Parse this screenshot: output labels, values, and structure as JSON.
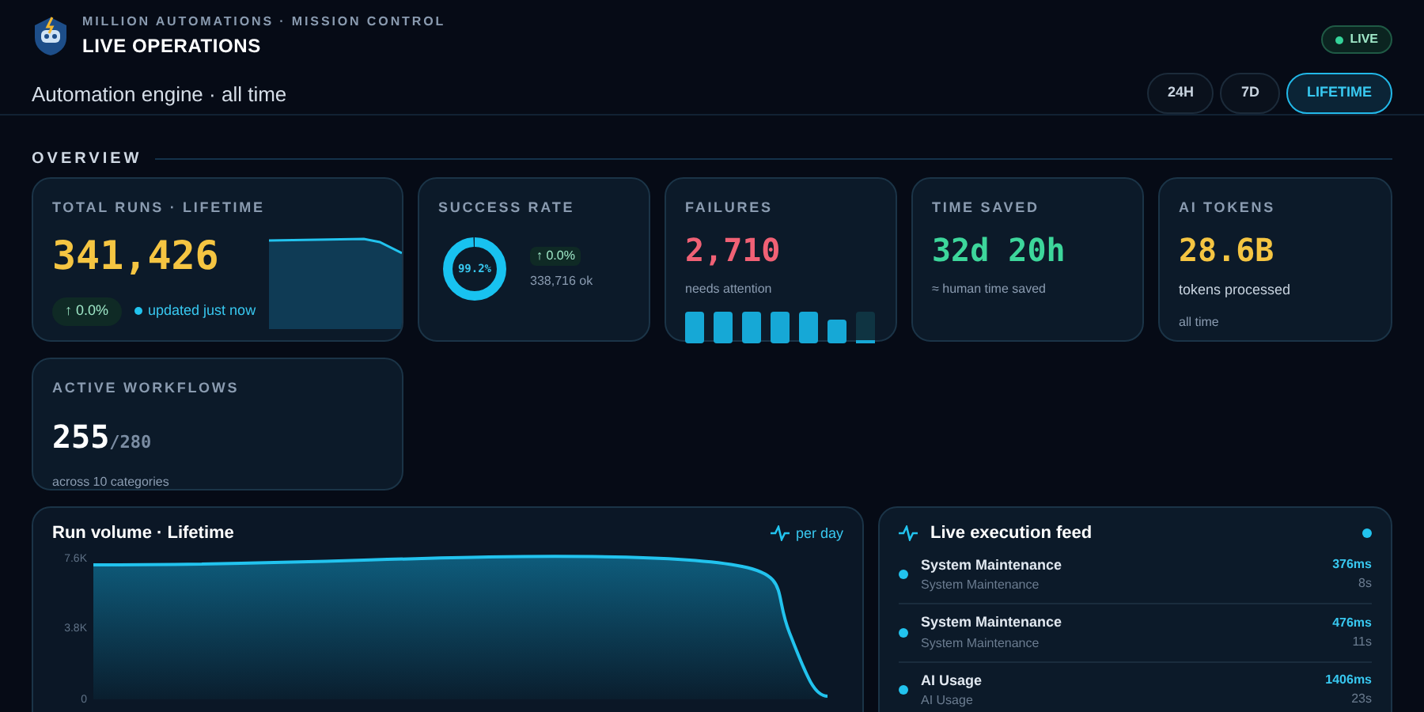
{
  "header": {
    "overline": "MILLION AUTOMATIONS · MISSION CONTROL",
    "title": "LIVE OPERATIONS",
    "subtitle": "Automation engine · all time",
    "live_badge": {
      "label": "LIVE",
      "on": true
    },
    "ranges": [
      {
        "label": "24H",
        "selected": false
      },
      {
        "label": "7D",
        "selected": false
      },
      {
        "label": "LIFETIME",
        "selected": true
      }
    ]
  },
  "overview": {
    "heading": "OVERVIEW",
    "total_runs": {
      "label": "TOTAL RUNS · LIFETIME",
      "value": "341,426",
      "delta": "↑ 0.0%",
      "status": "updated just now"
    },
    "success_rate": {
      "label": "SUCCESS RATE",
      "value": "99.2%",
      "delta": "↑ 0.0%",
      "detail": "338,716 ok"
    },
    "failures": {
      "label": "FAILURES",
      "value": "2,710",
      "detail": "needs attention"
    },
    "time_saved": {
      "label": "TIME SAVED",
      "value": "32d 20h",
      "detail": "≈ human time saved"
    },
    "ai_tokens": {
      "label": "AI TOKENS",
      "value": "28.6B",
      "detail": "tokens processed",
      "note": "all time"
    },
    "active_workflows": {
      "label": "ACTIVE WORKFLOWS",
      "value": "255",
      "total": "/280",
      "detail": "across 10 categories"
    }
  },
  "run_volume": {
    "title": "Run volume · Lifetime",
    "unit": "per day",
    "axis_labels": [
      "7.6K",
      "3.8K",
      "0"
    ]
  },
  "feed": {
    "title": "Live execution feed",
    "items": [
      {
        "name": "System Maintenance",
        "category": "System Maintenance",
        "duration": "376ms",
        "ago": "8s"
      },
      {
        "name": "System Maintenance",
        "category": "System Maintenance",
        "duration": "476ms",
        "ago": "11s"
      },
      {
        "name": "AI Usage",
        "category": "AI Usage",
        "duration": "1406ms",
        "ago": "23s"
      }
    ]
  }
}
